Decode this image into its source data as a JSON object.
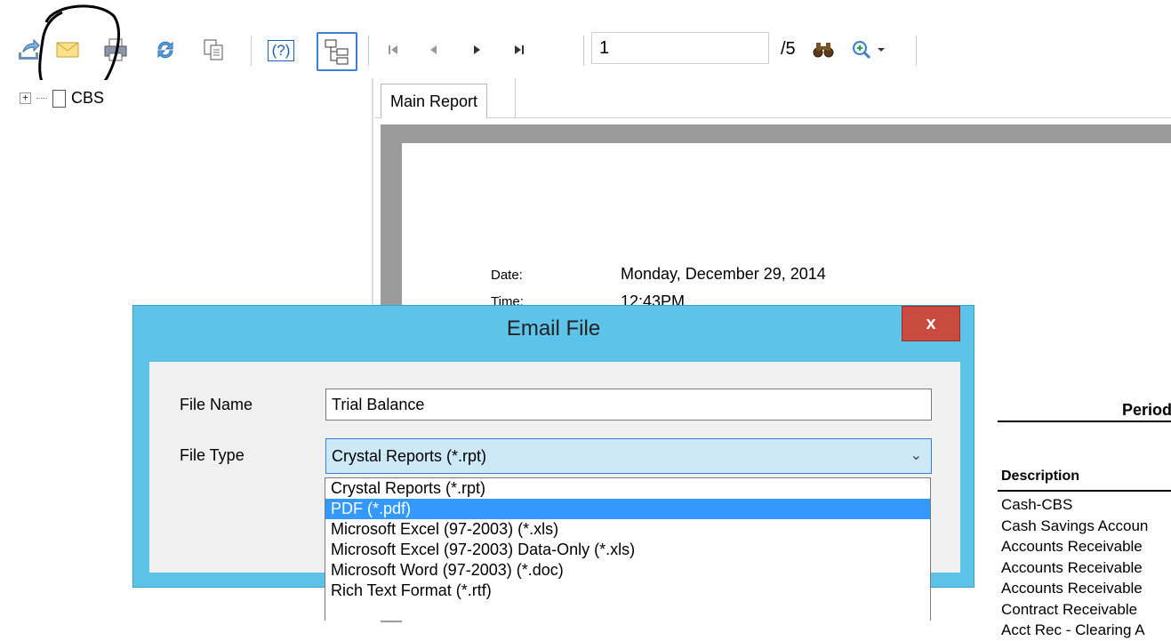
{
  "toolbar": {
    "buttons": [
      {
        "name": "export-icon"
      },
      {
        "name": "email-icon"
      },
      {
        "name": "print-icon"
      },
      {
        "name": "refresh-icon"
      },
      {
        "name": "copy-icon"
      },
      {
        "name": "help-icon",
        "label": "(?)"
      },
      {
        "name": "group-tree-icon"
      },
      {
        "name": "first-page-icon"
      },
      {
        "name": "previous-page-icon"
      },
      {
        "name": "next-page-icon"
      },
      {
        "name": "last-page-icon"
      },
      {
        "name": "find-icon"
      },
      {
        "name": "zoom-icon"
      }
    ],
    "current_page": "1",
    "page_total": "/5"
  },
  "tree": {
    "root_label": "CBS",
    "expander": "+"
  },
  "report": {
    "tab_label": "Main Report",
    "date_label": "Date:",
    "date_value": "Monday, December 29, 2014",
    "time_label": "Time:",
    "time_value": "12:43PM",
    "periods_label": "Periods",
    "description_header": "Description",
    "descriptions": [
      "Cash-CBS",
      "Cash Savings Accoun",
      "Accounts Receivable",
      "Accounts Receivable",
      "Accounts Receivable",
      "Contract Receivable",
      "Acct Rec - Clearing A"
    ]
  },
  "dialog": {
    "title": "Email File",
    "close_label": "x",
    "file_name_label": "File Name",
    "file_name_value": "Trial Balance",
    "file_type_label": "File Type",
    "file_type_selected": "Crystal Reports (*.rpt)",
    "file_type_options": [
      "Crystal Reports (*.rpt)",
      "PDF (*.pdf)",
      "Microsoft Excel (97-2003) (*.xls)",
      "Microsoft Excel (97-2003) Data-Only (*.xls)",
      "Microsoft Word (97-2003) (*.doc)",
      "Rich Text Format (*.rtf)"
    ],
    "highlighted_option": "PDF (*.pdf)"
  },
  "colors": {
    "dialog_frame": "#5ec3e8",
    "close_button": "#c94a3e",
    "selection": "#3399ff",
    "report_background": "#9b9b9b"
  }
}
